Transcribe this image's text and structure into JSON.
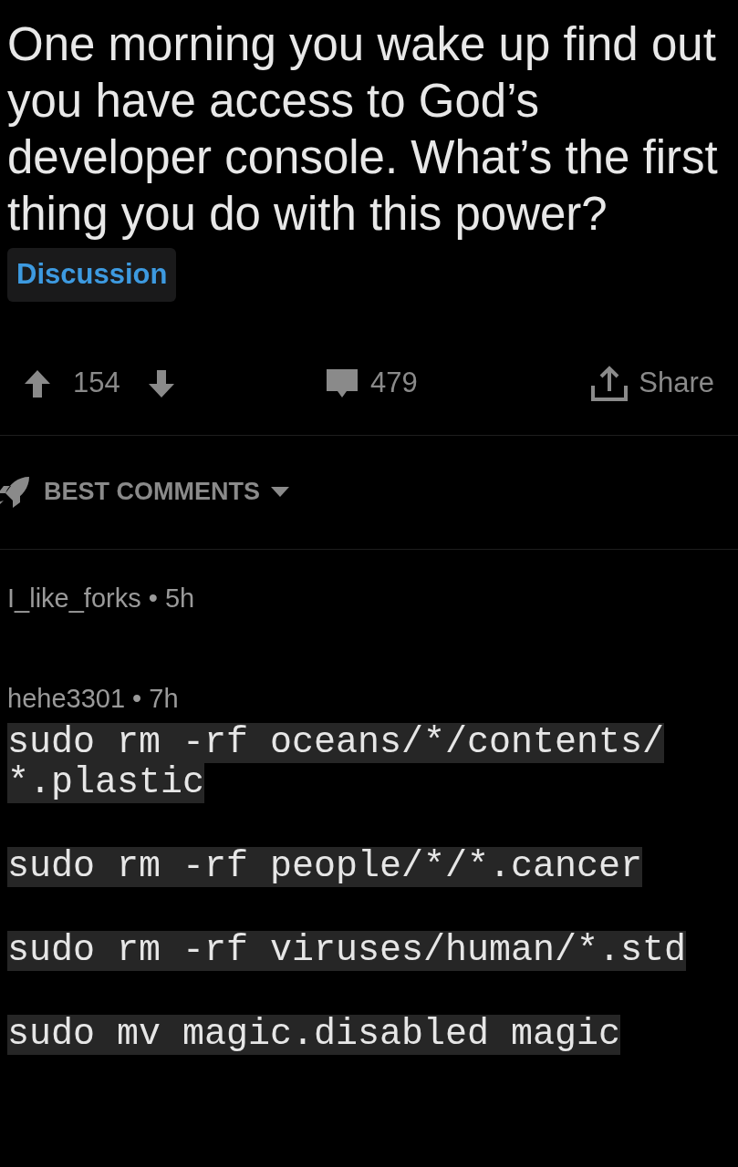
{
  "post": {
    "title": "One morning you wake up find out you have access to God’s developer console. What’s the first thing you do with this power?",
    "flair": "Discussion",
    "score": "154",
    "comments": "479",
    "share": "Share"
  },
  "sort": {
    "label": "BEST COMMENTS"
  },
  "comments": [
    {
      "author": "I_like_forks",
      "separator": "•",
      "age": "5h"
    },
    {
      "author": "hehe3301",
      "separator": "•",
      "age": "7h",
      "code": [
        [
          "sudo rm -rf oceans/*/contents/",
          "*.plastic"
        ],
        [
          "sudo rm -rf people/*/*.cancer"
        ],
        [
          "sudo rm -rf viruses/human/*.std"
        ],
        [
          "sudo mv magic.disabled magic"
        ]
      ]
    }
  ]
}
